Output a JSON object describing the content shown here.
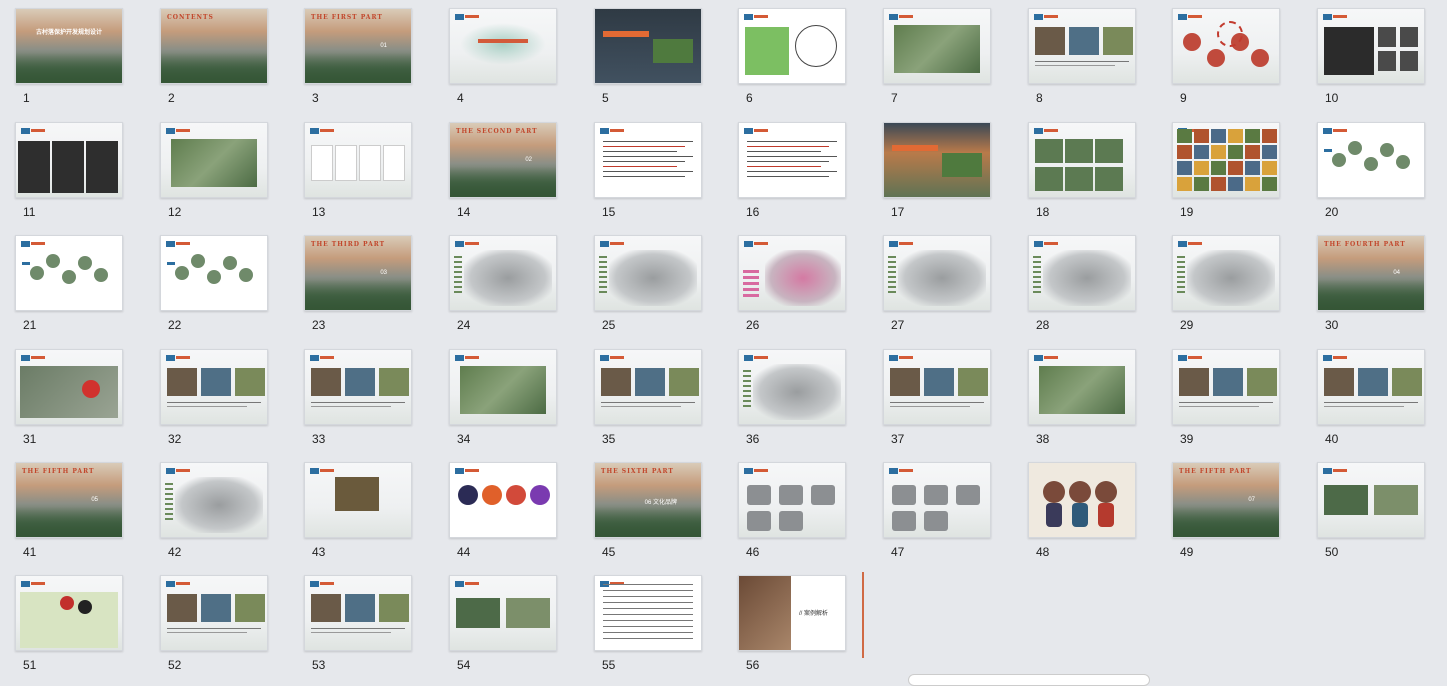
{
  "slides": [
    {
      "n": "1",
      "style": "landscape",
      "title": "古村落保护开发规划设计",
      "kind": "cover"
    },
    {
      "n": "2",
      "style": "landscape",
      "title": "CONTENTS",
      "kind": "cover"
    },
    {
      "n": "3",
      "style": "landscape",
      "title": "THE FIRST PART",
      "part": "01",
      "kind": "part"
    },
    {
      "n": "4",
      "style": "light",
      "title": "",
      "kind": "mist"
    },
    {
      "n": "5",
      "style": "dark",
      "title": "",
      "kind": "photo"
    },
    {
      "n": "6",
      "style": "white",
      "title": "",
      "kind": "map"
    },
    {
      "n": "7",
      "style": "light",
      "title": "",
      "kind": "aerial"
    },
    {
      "n": "8",
      "style": "light",
      "title": "",
      "kind": "photos3"
    },
    {
      "n": "9",
      "style": "light",
      "title": "",
      "kind": "collage"
    },
    {
      "n": "10",
      "style": "light",
      "title": "",
      "kind": "darkmap"
    },
    {
      "n": "11",
      "style": "light",
      "title": "",
      "kind": "darkmap3"
    },
    {
      "n": "12",
      "style": "light",
      "title": "",
      "kind": "aerial"
    },
    {
      "n": "13",
      "style": "light",
      "title": "",
      "kind": "cards"
    },
    {
      "n": "14",
      "style": "landscape",
      "title": "THE SECOND PART",
      "part": "02",
      "kind": "part"
    },
    {
      "n": "15",
      "style": "white",
      "title": "",
      "kind": "text"
    },
    {
      "n": "16",
      "style": "white",
      "title": "",
      "kind": "text"
    },
    {
      "n": "17",
      "style": "sunset",
      "title": "",
      "kind": "photo"
    },
    {
      "n": "18",
      "style": "light",
      "title": "",
      "kind": "photos4"
    },
    {
      "n": "19",
      "style": "light",
      "title": "",
      "kind": "mosaic"
    },
    {
      "n": "20",
      "style": "white",
      "title": "",
      "kind": "bubbles"
    },
    {
      "n": "21",
      "style": "white",
      "title": "",
      "kind": "bubbles"
    },
    {
      "n": "22",
      "style": "white",
      "title": "",
      "kind": "bubbles"
    },
    {
      "n": "23",
      "style": "landscape",
      "title": "THE THIRD PART",
      "part": "03",
      "kind": "part"
    },
    {
      "n": "24",
      "style": "light",
      "title": "",
      "kind": "plan"
    },
    {
      "n": "25",
      "style": "light",
      "title": "",
      "kind": "plan"
    },
    {
      "n": "26",
      "style": "light",
      "title": "",
      "kind": "planpink"
    },
    {
      "n": "27",
      "style": "light",
      "title": "",
      "kind": "plan"
    },
    {
      "n": "28",
      "style": "light",
      "title": "",
      "kind": "plan"
    },
    {
      "n": "29",
      "style": "light",
      "title": "",
      "kind": "plan"
    },
    {
      "n": "30",
      "style": "landscape",
      "title": "THE FOURTH PART",
      "part": "04",
      "kind": "part"
    },
    {
      "n": "31",
      "style": "light",
      "title": "",
      "kind": "aerialred"
    },
    {
      "n": "32",
      "style": "light",
      "title": "",
      "kind": "photos3"
    },
    {
      "n": "33",
      "style": "light",
      "title": "",
      "kind": "photos3"
    },
    {
      "n": "34",
      "style": "light",
      "title": "",
      "kind": "aerial"
    },
    {
      "n": "35",
      "style": "light",
      "title": "",
      "kind": "photos3"
    },
    {
      "n": "36",
      "style": "light",
      "title": "",
      "kind": "plan"
    },
    {
      "n": "37",
      "style": "light",
      "title": "",
      "kind": "photos3"
    },
    {
      "n": "38",
      "style": "light",
      "title": "",
      "kind": "aerial"
    },
    {
      "n": "39",
      "style": "light",
      "title": "",
      "kind": "photos3"
    },
    {
      "n": "40",
      "style": "light",
      "title": "",
      "kind": "photos3"
    },
    {
      "n": "41",
      "style": "landscape",
      "title": "THE FIFTH PART",
      "part": "05",
      "kind": "part"
    },
    {
      "n": "42",
      "style": "light",
      "title": "",
      "kind": "plan"
    },
    {
      "n": "43",
      "style": "light",
      "title": "",
      "kind": "photo1"
    },
    {
      "n": "44",
      "style": "white",
      "title": "",
      "kind": "logos"
    },
    {
      "n": "45",
      "style": "landscape",
      "title": "THE SIXTH PART",
      "part": "06 文化品牌",
      "kind": "part"
    },
    {
      "n": "46",
      "style": "light",
      "title": "",
      "kind": "products"
    },
    {
      "n": "47",
      "style": "light",
      "title": "",
      "kind": "products"
    },
    {
      "n": "48",
      "style": "beige",
      "title": "",
      "kind": "dolls"
    },
    {
      "n": "49",
      "style": "landscape",
      "title": "THE FIFTH PART",
      "part": "07",
      "kind": "part"
    },
    {
      "n": "50",
      "style": "light",
      "title": "",
      "kind": "photos2"
    },
    {
      "n": "51",
      "style": "light",
      "title": "",
      "kind": "planmap"
    },
    {
      "n": "52",
      "style": "light",
      "title": "",
      "kind": "photos3"
    },
    {
      "n": "53",
      "style": "light",
      "title": "",
      "kind": "photos3"
    },
    {
      "n": "54",
      "style": "light",
      "title": "",
      "kind": "photos2"
    },
    {
      "n": "55",
      "style": "white",
      "title": "",
      "kind": "doc"
    },
    {
      "n": "56",
      "style": "white",
      "title": "// 案例解析",
      "kind": "case"
    }
  ],
  "colors": {
    "accent": "#c2472c",
    "blue": "#2c6ea0",
    "background": "#e6e8ec"
  }
}
